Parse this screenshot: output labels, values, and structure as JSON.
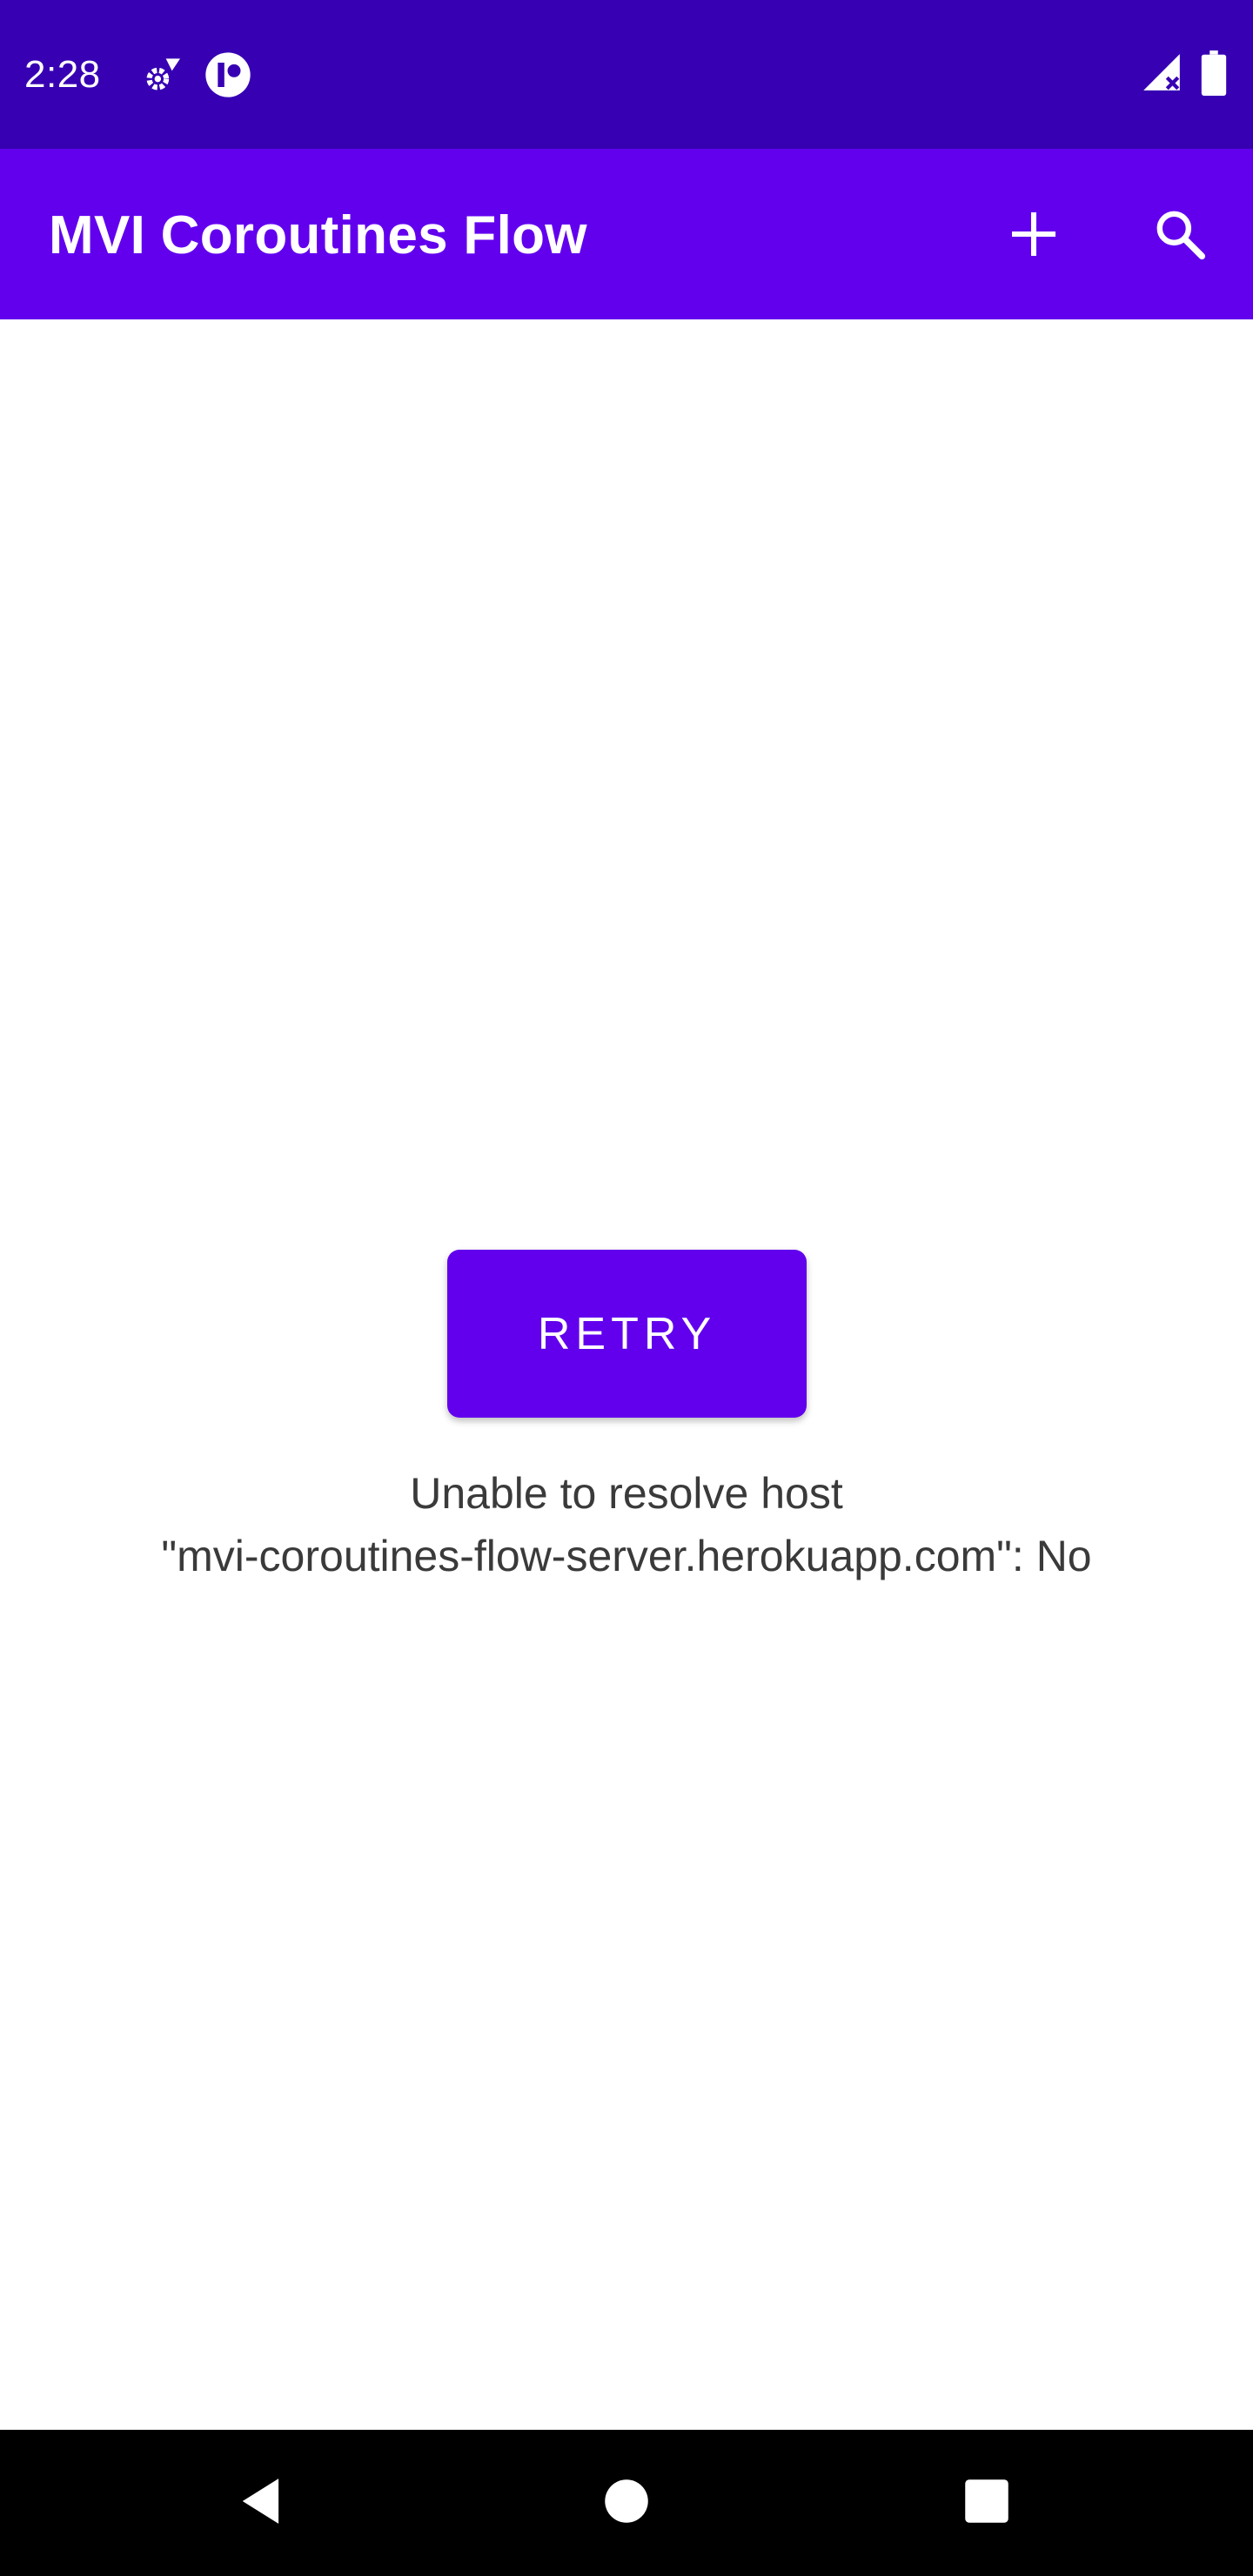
{
  "status_bar": {
    "time": "2:28",
    "icons": [
      "settings-gear-icon",
      "app-notification-icon",
      "signal-no-connection-icon",
      "battery-icon"
    ]
  },
  "app_bar": {
    "title": "MVI Coroutines Flow",
    "actions": [
      "add-icon",
      "search-icon"
    ]
  },
  "main": {
    "retry_label": "RETRY",
    "error_line_1": "Unable to resolve host",
    "error_line_2": "\"mvi-coroutines-flow-server.herokuapp.com\": No"
  },
  "nav_bar": {
    "buttons": [
      "back-icon",
      "home-icon",
      "recents-icon"
    ]
  },
  "colors": {
    "status_bar": "#3700B3",
    "primary": "#6200EE",
    "nav_bar": "#000000",
    "text": "#3a3a3a"
  }
}
